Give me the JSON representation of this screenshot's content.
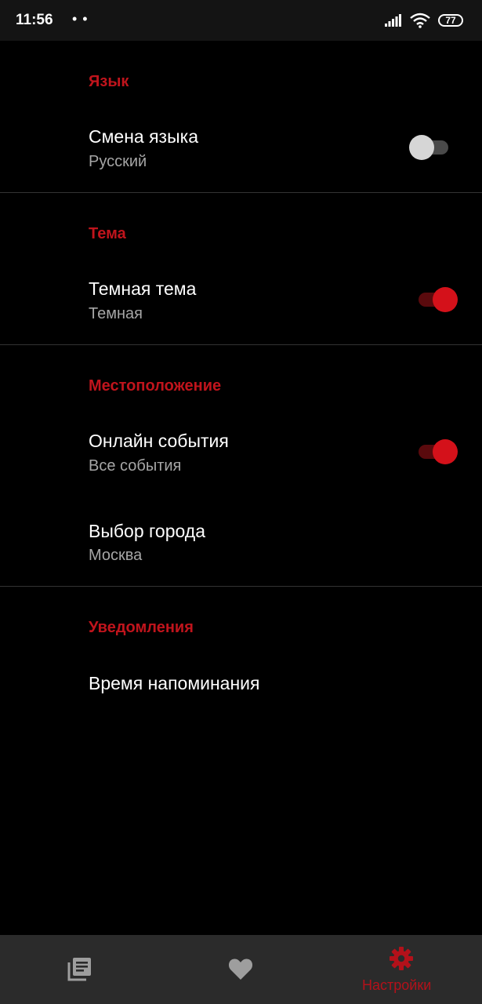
{
  "status_bar": {
    "time": "11:56",
    "notification_dots": "• •",
    "battery": "77"
  },
  "sections": {
    "language": {
      "header": "Язык",
      "change_language": {
        "title": "Смена языка",
        "summary": "Русский",
        "enabled": false
      }
    },
    "theme": {
      "header": "Тема",
      "dark_theme": {
        "title": "Темная тема",
        "summary": "Темная",
        "enabled": true
      }
    },
    "location": {
      "header": "Местоположение",
      "online_events": {
        "title": "Онлайн события",
        "summary": "Все события",
        "enabled": true
      },
      "city_choice": {
        "title": "Выбор города",
        "summary": "Москва"
      }
    },
    "notifications": {
      "header": "Уведомления",
      "reminder_time": {
        "title": "Время напоминания"
      }
    }
  },
  "bottom_nav": {
    "items": [
      {
        "icon": "news-list-icon",
        "label": "",
        "active": false
      },
      {
        "icon": "heart-icon",
        "label": "",
        "active": false
      },
      {
        "icon": "gear-icon",
        "label": "Настройки",
        "active": true
      }
    ]
  },
  "colors": {
    "accent": "#c0141c",
    "background": "#000000",
    "nav_background": "#2b2b2b",
    "inactive_icon": "#9e9e9e"
  }
}
